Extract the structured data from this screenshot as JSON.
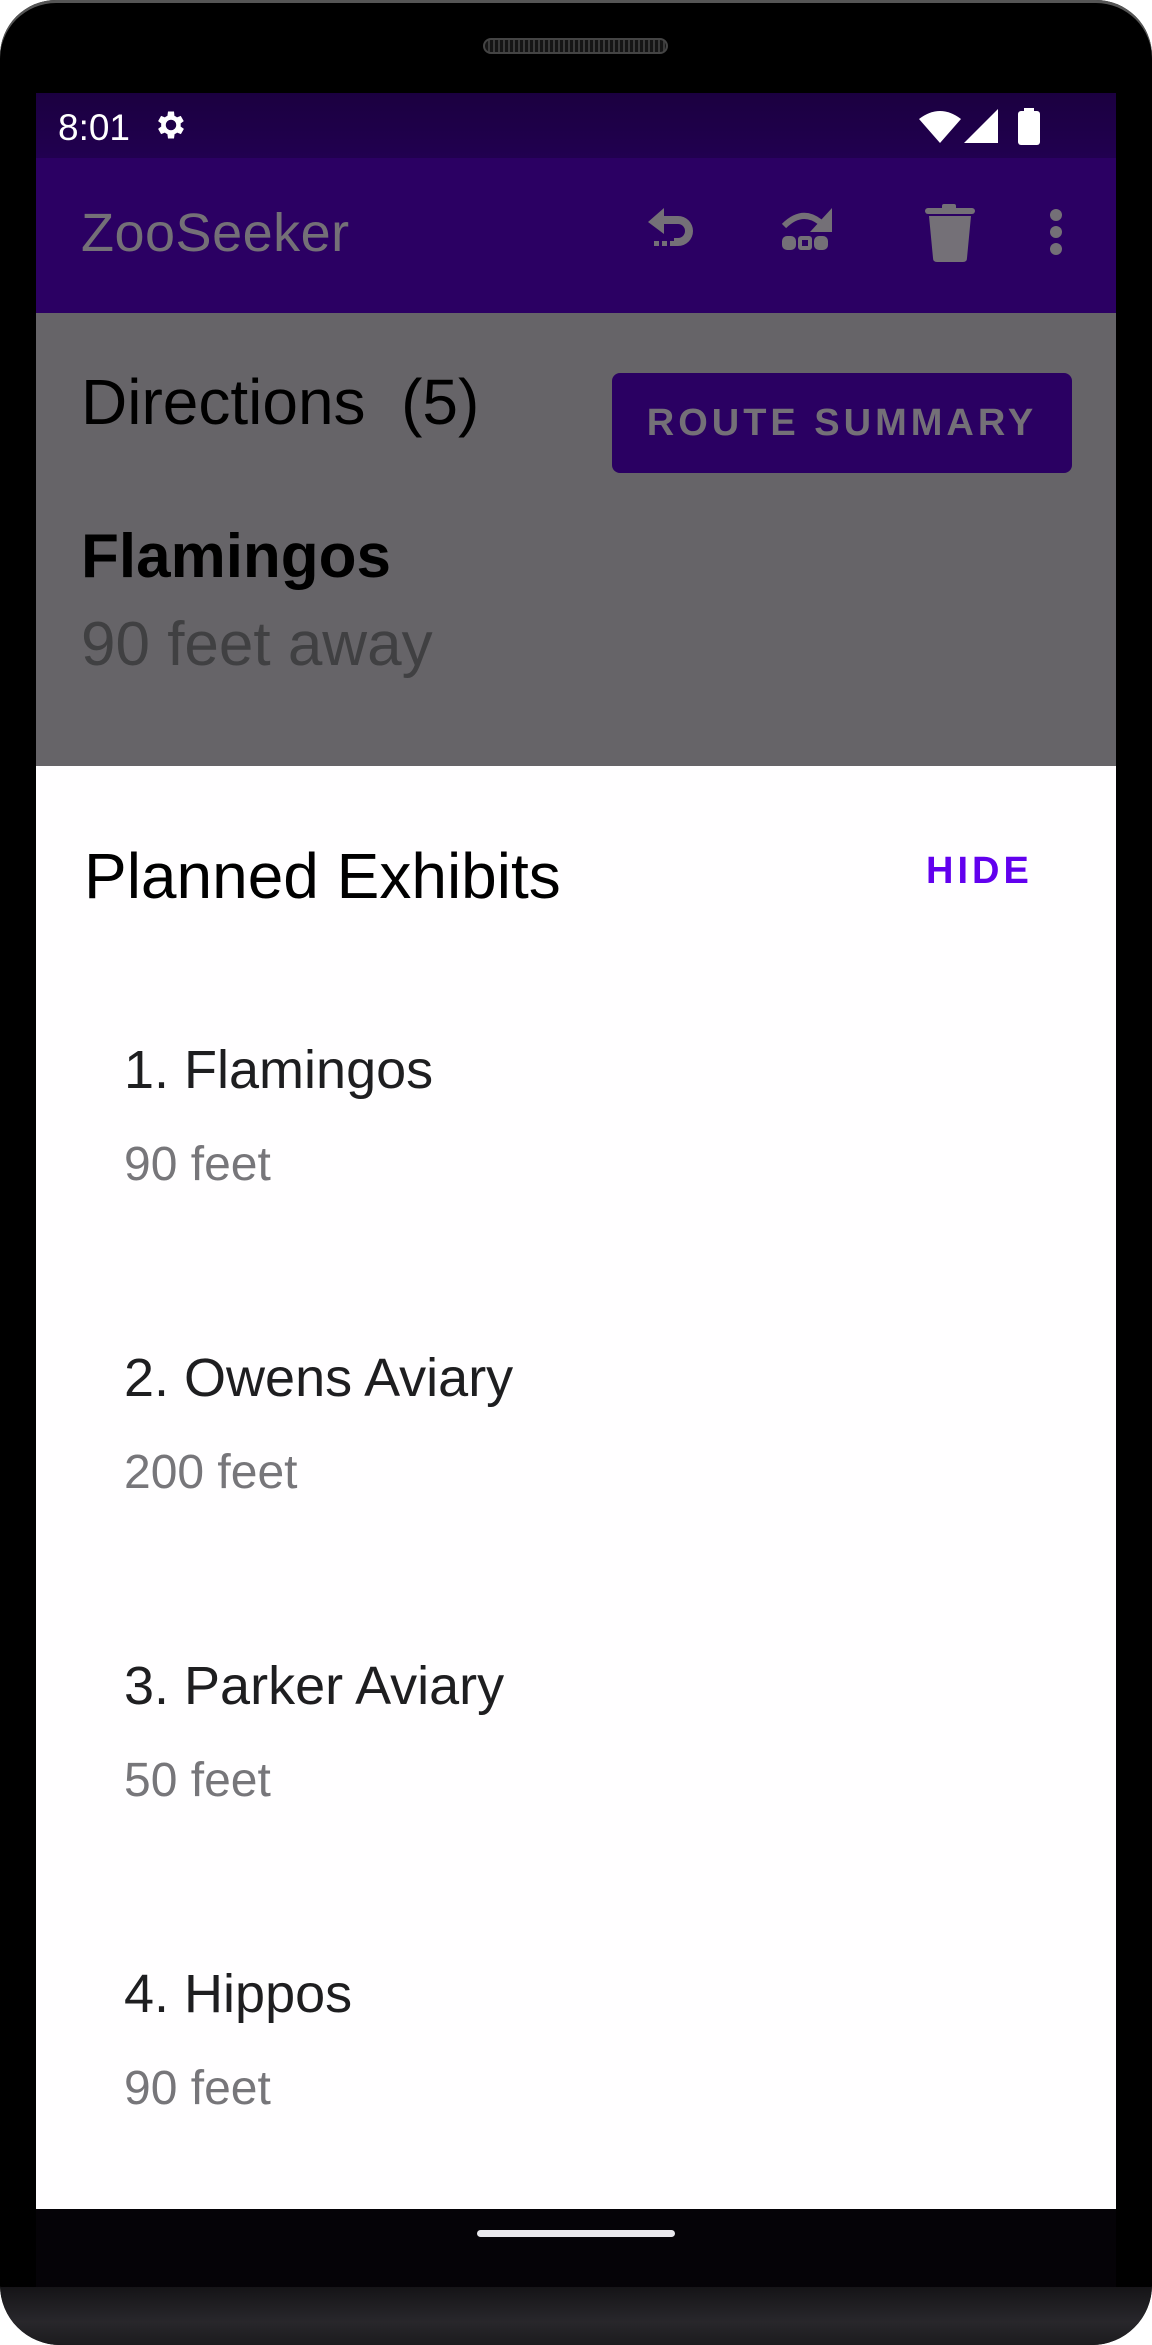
{
  "status_bar": {
    "time": "8:01",
    "icons": [
      "settings-gear-icon",
      "wifi-icon",
      "cell-signal-icon",
      "battery-icon"
    ]
  },
  "toolbar": {
    "title": "ZooSeeker",
    "actions": [
      {
        "name": "previous-step-icon",
        "label": "Previous"
      },
      {
        "name": "skip-next-icon",
        "label": "Skip"
      },
      {
        "name": "delete-icon",
        "label": "Delete"
      },
      {
        "name": "more-options-icon",
        "label": "More options"
      }
    ]
  },
  "directions": {
    "title": "Directions  (5)",
    "route_summary_label": "ROUTE SUMMARY",
    "current_exhibit": {
      "name": "Flamingos",
      "distance": "90 feet away"
    }
  },
  "planned_exhibits": {
    "title": "Planned Exhibits",
    "hide_label": "HIDE",
    "items": [
      {
        "label": "1. Flamingos",
        "distance": "90 feet"
      },
      {
        "label": "2. Owens Aviary",
        "distance": "200 feet"
      },
      {
        "label": "3. Parker Aviary",
        "distance": "50 feet"
      },
      {
        "label": "4. Hippos",
        "distance": "90 feet"
      }
    ]
  },
  "colors": {
    "primary": "#6200ee",
    "toolbar_dimmed": "#2b0063",
    "scrim": "#666468"
  }
}
